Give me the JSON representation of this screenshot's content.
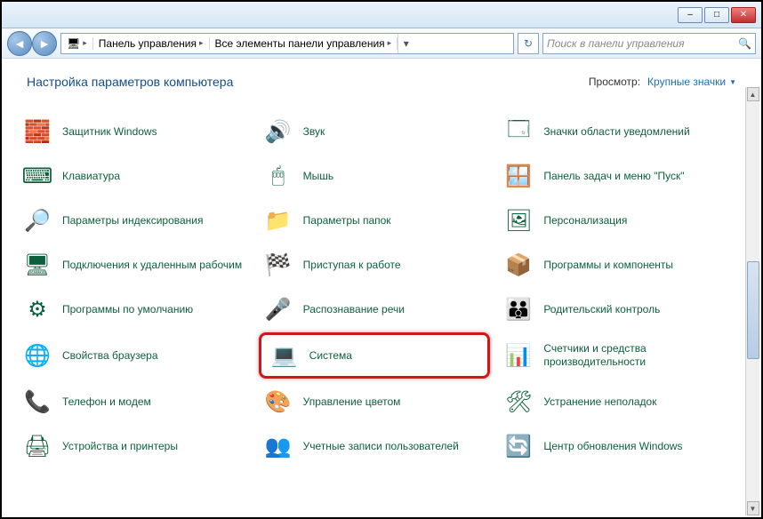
{
  "window": {
    "minimize": "–",
    "maximize": "□",
    "close": "✕"
  },
  "nav": {
    "back": "◄",
    "forward": "►",
    "refresh": "↻"
  },
  "breadcrumb": {
    "root_icon": "🖥",
    "seg1": "Панель управления",
    "seg2": "Все элементы панели управления"
  },
  "search": {
    "placeholder": "Поиск в панели управления",
    "icon": "🔍"
  },
  "header": {
    "title": "Настройка параметров компьютера",
    "view_label": "Просмотр:",
    "view_value": "Крупные значки"
  },
  "items": [
    {
      "id": "defender",
      "label": "Защитник Windows",
      "icon": "🧱"
    },
    {
      "id": "sound",
      "label": "Звук",
      "icon": "🔊"
    },
    {
      "id": "notification-icons",
      "label": "Значки области уведомлений",
      "icon": "🗔"
    },
    {
      "id": "keyboard",
      "label": "Клавиатура",
      "icon": "⌨"
    },
    {
      "id": "mouse",
      "label": "Мышь",
      "icon": "🖱"
    },
    {
      "id": "taskbar",
      "label": "Панель задач и меню \"Пуск\"",
      "icon": "🪟"
    },
    {
      "id": "indexing",
      "label": "Параметры индексирования",
      "icon": "🔎"
    },
    {
      "id": "folder-options",
      "label": "Параметры папок",
      "icon": "📁"
    },
    {
      "id": "personalization",
      "label": "Персонализация",
      "icon": "🖼"
    },
    {
      "id": "remote",
      "label": "Подключения к удаленным рабочим",
      "icon": "🖥"
    },
    {
      "id": "getting-started",
      "label": "Приступая к работе",
      "icon": "🏁"
    },
    {
      "id": "programs",
      "label": "Программы и компоненты",
      "icon": "📦"
    },
    {
      "id": "default-programs",
      "label": "Программы по умолчанию",
      "icon": "⚙"
    },
    {
      "id": "speech",
      "label": "Распознавание речи",
      "icon": "🎤"
    },
    {
      "id": "parental",
      "label": "Родительский контроль",
      "icon": "👪"
    },
    {
      "id": "browser-props",
      "label": "Свойства браузера",
      "icon": "🌐"
    },
    {
      "id": "system",
      "label": "Система",
      "icon": "💻",
      "highlight": true
    },
    {
      "id": "perf-counters",
      "label": "Счетчики и средства производительности",
      "icon": "📊"
    },
    {
      "id": "phone-modem",
      "label": "Телефон и модем",
      "icon": "📞"
    },
    {
      "id": "color-mgmt",
      "label": "Управление цветом",
      "icon": "🎨"
    },
    {
      "id": "troubleshoot",
      "label": "Устранение неполадок",
      "icon": "🛠"
    },
    {
      "id": "devices-printers",
      "label": "Устройства и принтеры",
      "icon": "🖨"
    },
    {
      "id": "user-accounts",
      "label": "Учетные записи пользователей",
      "icon": "👥"
    },
    {
      "id": "windows-update",
      "label": "Центр обновления Windows",
      "icon": "🔄"
    }
  ]
}
